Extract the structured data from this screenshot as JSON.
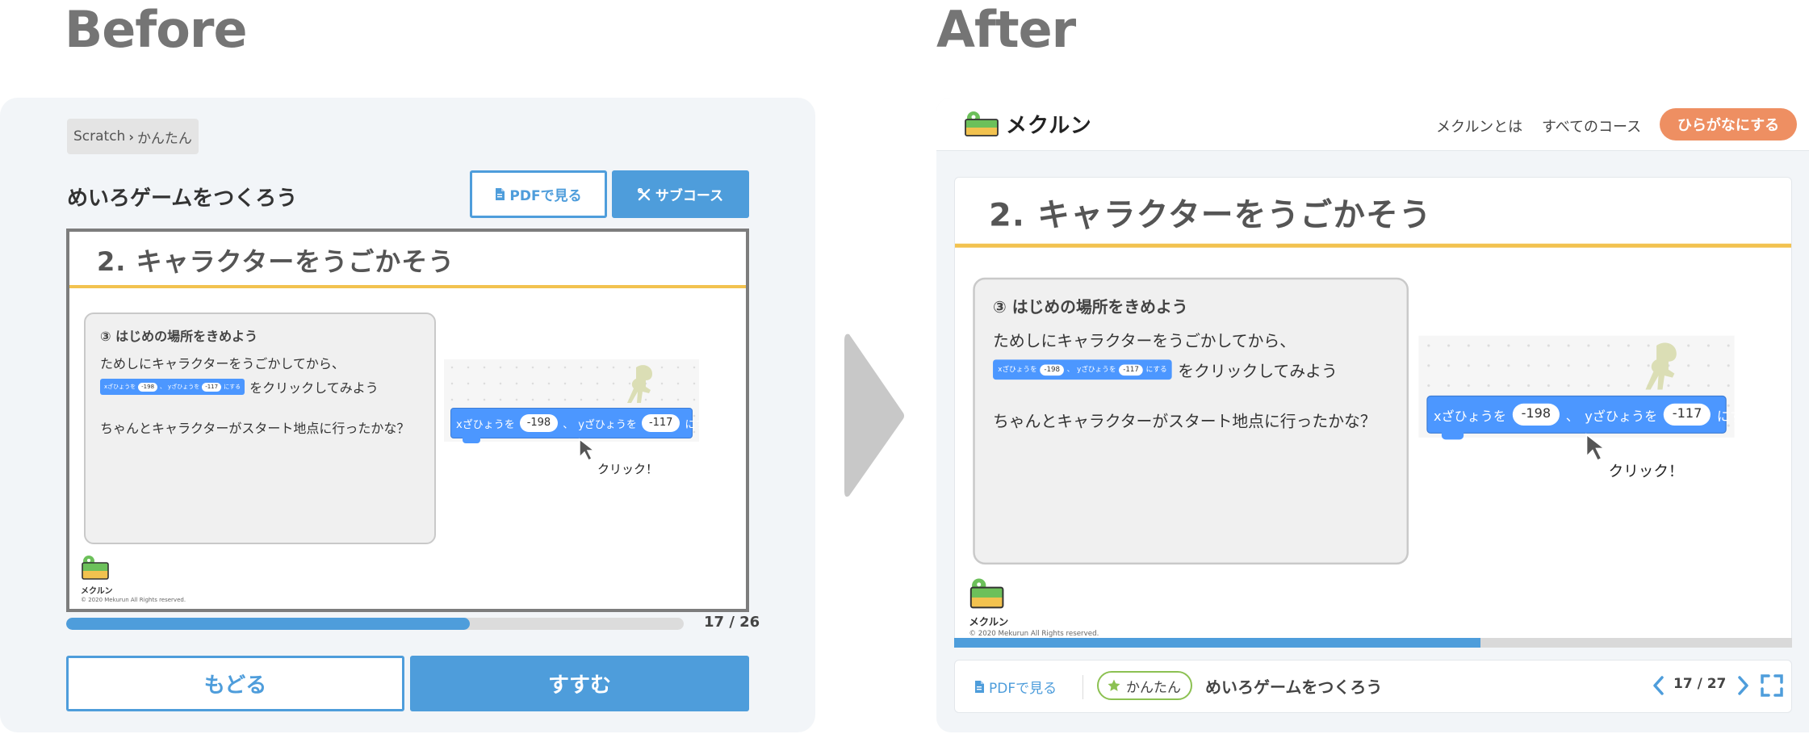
{
  "headings": {
    "before": "Before",
    "after": "After"
  },
  "colors": {
    "primary": "#4e9ddb",
    "accent_line": "#f2c24f",
    "hiragana_button": "#ee8f62",
    "level_badge": "#8cc152",
    "scratch_block": "#4c97ff"
  },
  "before": {
    "breadcrumb": {
      "parent": "Scratch",
      "separator": "›",
      "current": "かんたん"
    },
    "course_title": "めいろゲームをつくろう",
    "pdf_button": "PDFで見る",
    "subcourse_button": "サブコース",
    "progress": {
      "current": 17,
      "total": 26,
      "fraction": 0.654,
      "label": "17 / 26"
    },
    "back_button": "もどる",
    "next_button": "すすむ"
  },
  "slide": {
    "title": "2. キャラクターをうごかそう",
    "step_heading": "③ はじめの場所をきめよう",
    "line1": "ためしにキャラクターをうごかしてから、",
    "line2_suffix": "をクリックしてみよう",
    "line3": "ちゃんとキャラクターがスタート地点に行ったかな？",
    "block": {
      "x_label": "xざひょうを",
      "x_value": "-198",
      "sep": "、",
      "y_label": "yざひょうを",
      "y_value": "-117",
      "end": "にする"
    },
    "click_label": "クリック！",
    "logo_text": "メクルン",
    "copyright": "© 2020 Mekurun All Rights reserved."
  },
  "after": {
    "header": {
      "logo_text": "メクルン",
      "nav_about": "メクルンとは",
      "nav_courses": "すべてのコース",
      "hiragana_button": "ひらがなにする"
    },
    "progress": {
      "current": 17,
      "total": 27,
      "fraction": 0.628
    },
    "pdf_link": "PDFで見る",
    "level_badge": "かんたん",
    "course_title": "めいろゲームをつくろう",
    "page_label": "17 / 27"
  }
}
